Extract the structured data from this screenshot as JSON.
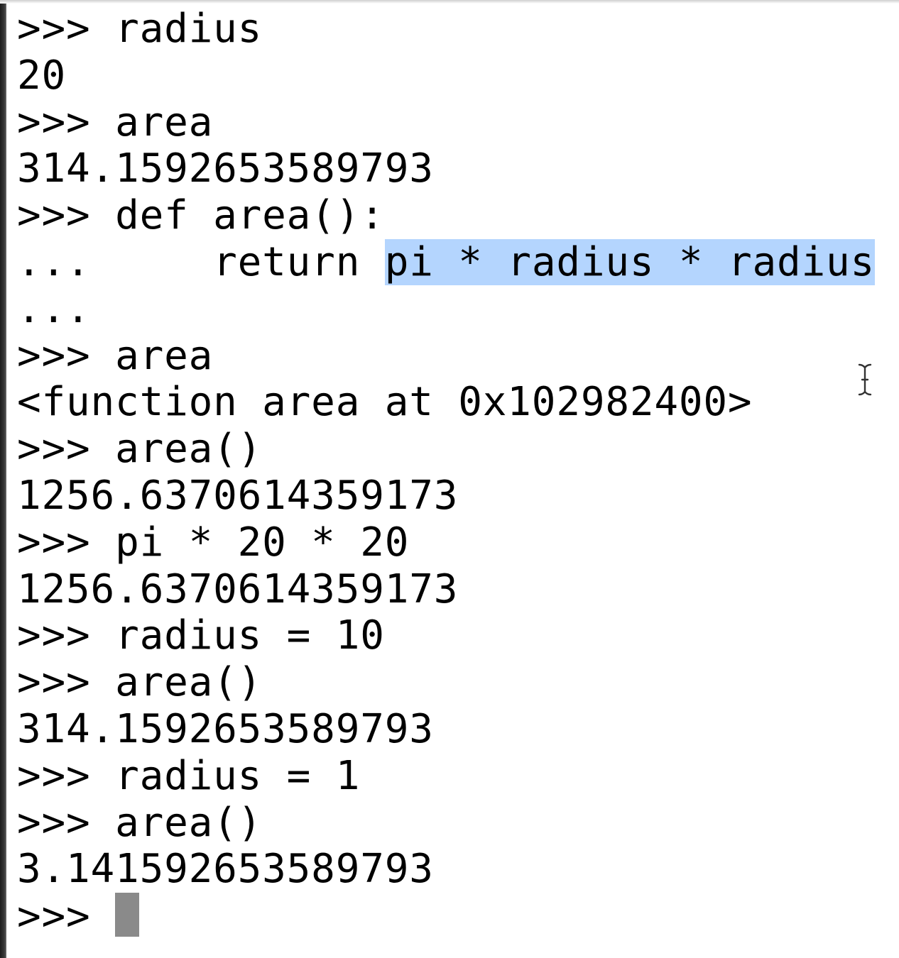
{
  "terminal": {
    "prompt": ">>>",
    "continuation": "...",
    "lines": {
      "l1_input": "radius",
      "l2_output": "20",
      "l3_input": "area",
      "l4_output": "314.1592653589793",
      "l5_input": "def area():",
      "l6_indent": "    return ",
      "l6_selected": "pi * radius * radius",
      "l8_input": "area",
      "l9_output": "<function area at 0x102982400>",
      "l10_input": "area()",
      "l11_output": "1256.6370614359173",
      "l12_input": "pi * 20 * 20",
      "l13_output": "1256.6370614359173",
      "l14_input": "radius = 10",
      "l15_input": "area()",
      "l16_output": "314.1592653589793",
      "l17_input": "radius = 1",
      "l18_input": "area()",
      "l19_output": "3.141592653589793"
    }
  },
  "icons": {
    "text_cursor": "ibeam-cursor-icon",
    "input_cursor": "block-cursor"
  },
  "colors": {
    "background": "#ffffff",
    "text": "#000000",
    "selection": "#b4d5fe",
    "cursor": "#8a8a8a"
  }
}
